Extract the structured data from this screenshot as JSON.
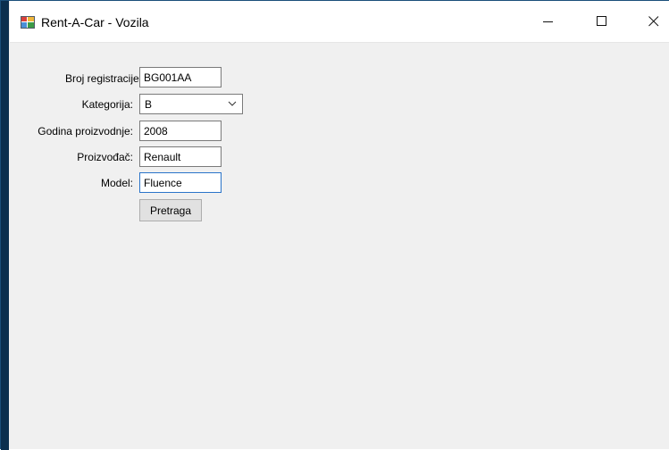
{
  "window": {
    "title": "Rent-A-Car - Vozila"
  },
  "form": {
    "registration_label": "Broj registracije:",
    "registration_value": "BG001AA",
    "category_label": "Kategorija:",
    "category_value": "B",
    "year_label": "Godina proizvodnje:",
    "year_value": "2008",
    "manufacturer_label": "Proizvođač:",
    "manufacturer_value": "Renault",
    "model_label": "Model:",
    "model_value": "Fluence",
    "search_button": "Pretraga"
  },
  "icons": {
    "app": "app-window-icon",
    "minimize": "minimize-icon",
    "maximize": "maximize-icon",
    "close": "close-icon",
    "dropdown": "chevron-down-icon"
  },
  "colors": {
    "accent": "#2a74c9",
    "window_bg": "#f0f0f0"
  }
}
